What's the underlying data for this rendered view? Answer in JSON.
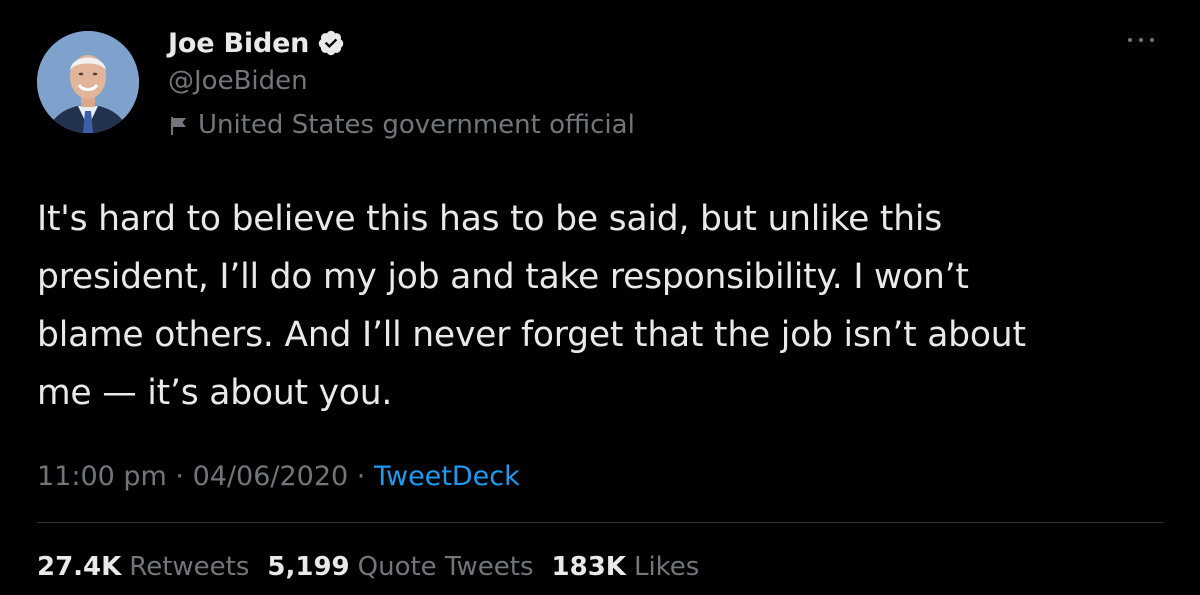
{
  "author": {
    "display_name": "Joe Biden",
    "handle": "@JoeBiden",
    "label": "United States government official",
    "verified": true
  },
  "tweet": {
    "text": "It's hard to believe this has to be said, but unlike this\npresident, I’ll do my job and take responsibility. I won’t\nblame others. And I’ll never forget that the job isn’t about\nme — it’s about you.",
    "time": "11:00 pm",
    "date": "04/06/2020",
    "separator": " · ",
    "source": "TweetDeck"
  },
  "stats": {
    "retweets_count": "27.4K",
    "retweets_label": "Retweets",
    "quotes_count": "5,199",
    "quotes_label": "Quote Tweets",
    "likes_count": "183K",
    "likes_label": "Likes"
  },
  "icons": {
    "verified": "verified-badge-icon",
    "label": "flag-icon",
    "more": "more-options-icon"
  },
  "colors": {
    "background": "#000000",
    "primary_text": "#e7e9ea",
    "secondary_text": "#71767b",
    "link": "#1d9bf0"
  }
}
